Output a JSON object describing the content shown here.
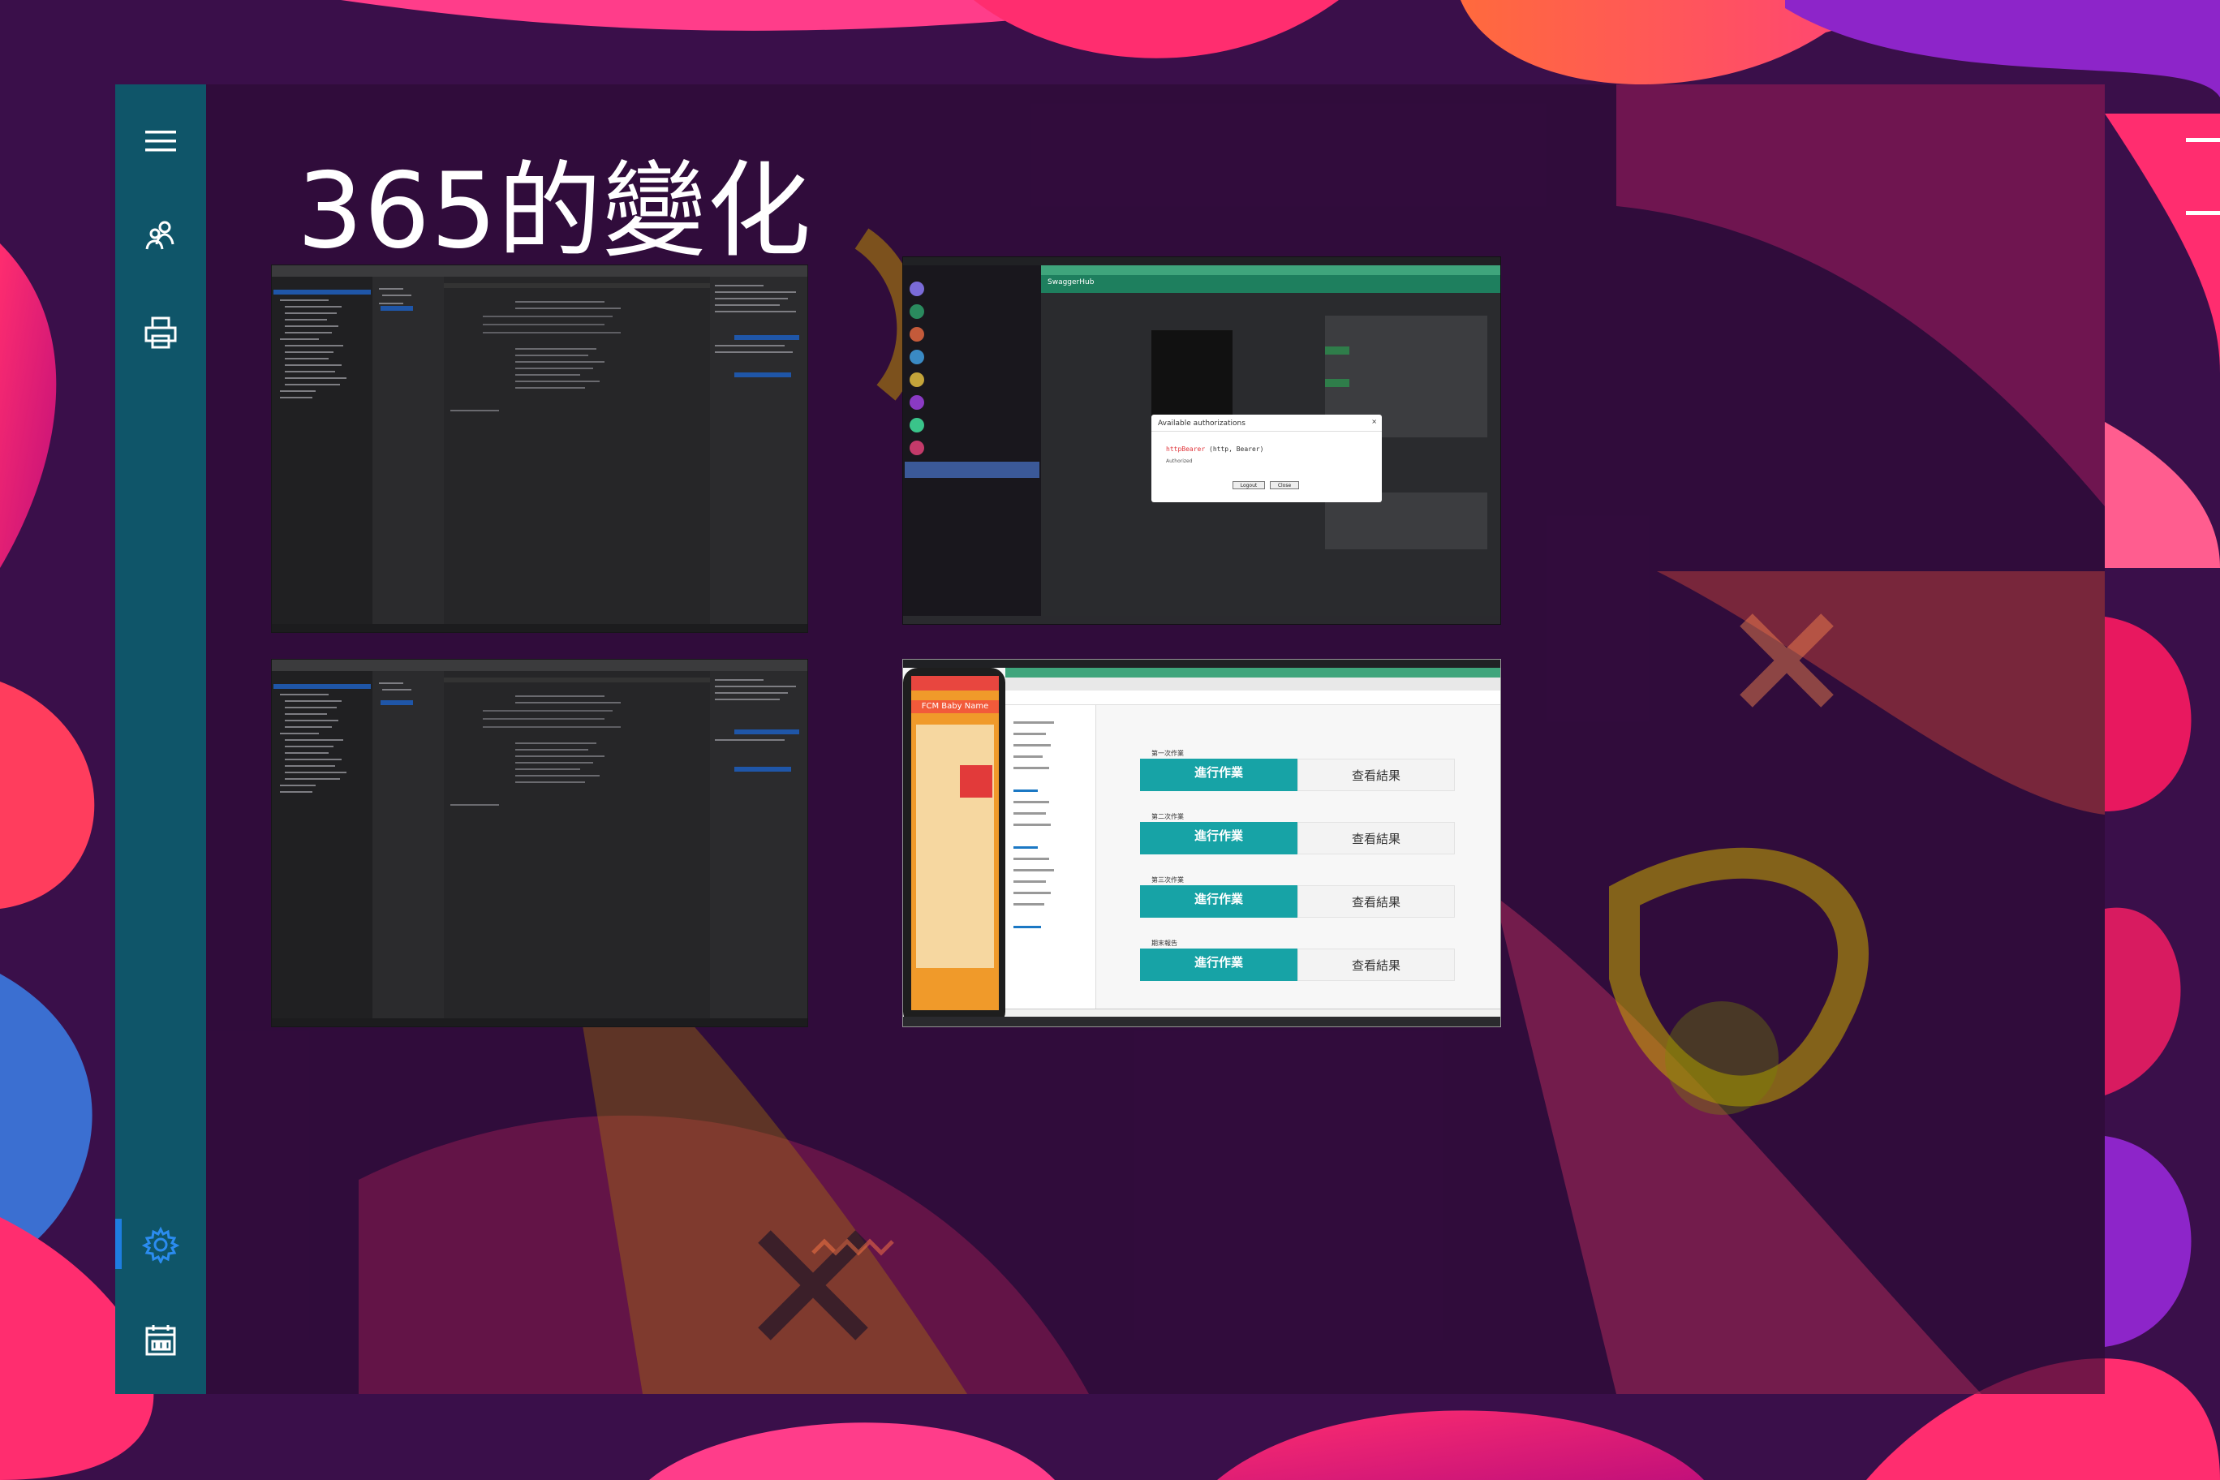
{
  "slide": {
    "title": "365的變化"
  },
  "sidebar": {
    "items": [
      {
        "icon": "hamburger-menu-icon"
      },
      {
        "icon": "people-icon"
      },
      {
        "icon": "printer-icon"
      },
      {
        "icon": "gear-icon",
        "active": true
      },
      {
        "icon": "calendar-icon"
      }
    ],
    "accent": "#1e7de0",
    "background": "#0f5569"
  },
  "screenshots": {
    "swagger_modal": {
      "title": "Available authorizations",
      "scheme": "httpBearer",
      "scheme_type": "(http, Bearer)",
      "status": "Authorized",
      "logout_label": "Logout",
      "close_label": "Close",
      "app_name": "SwaggerHub"
    },
    "elearn": {
      "tasks": [
        {
          "label": "第一次作業",
          "go": "進行作業",
          "result": "查看結果"
        },
        {
          "label": "第二次作業",
          "go": "進行作業",
          "result": "查看結果"
        },
        {
          "label": "第三次作業",
          "go": "進行作業",
          "result": "查看結果"
        },
        {
          "label": "期末報告",
          "go": "進行作業",
          "result": "查看結果"
        }
      ],
      "phone_title": "FCM Baby Name"
    }
  },
  "colors": {
    "teal_button": "#17a3a6",
    "bg_pink": "#e8185f",
    "bg_purple": "#3a0f4a"
  }
}
